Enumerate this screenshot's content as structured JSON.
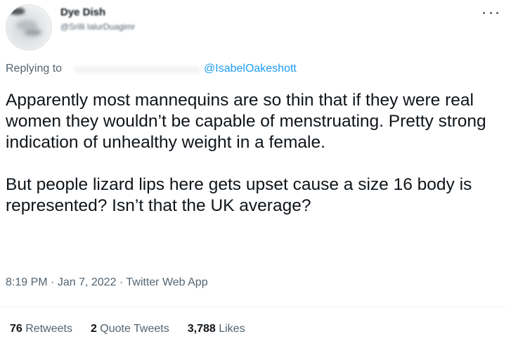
{
  "author": {
    "display_name": "Dye Dish",
    "handle": "@Srilli lalurDuagimr"
  },
  "reply": {
    "label": "Replying to",
    "mention": "@IsabelOakeshott"
  },
  "tweet": {
    "paragraphs": [
      "Apparently most mannequins are so thin that if they were real women they wouldn’t be capable of menstruating. Pretty strong indication of unhealthy weight in a female.",
      "But people lizard lips here gets upset cause a size 16 body is represented? Isn’t that the UK average?"
    ],
    "time": "8:19 PM",
    "date": "Jan 7, 2022",
    "source": "Twitter Web App"
  },
  "stats": {
    "retweets_count": "76",
    "retweets_label": "Retweets",
    "quotes_count": "2",
    "quotes_label": "Quote Tweets",
    "likes_count": "3,788",
    "likes_label": "Likes"
  },
  "icons": {
    "more": "more-horizontal-icon"
  },
  "colors": {
    "text": "#0f1419",
    "secondary": "#536471",
    "link": "#1d9bf0"
  }
}
